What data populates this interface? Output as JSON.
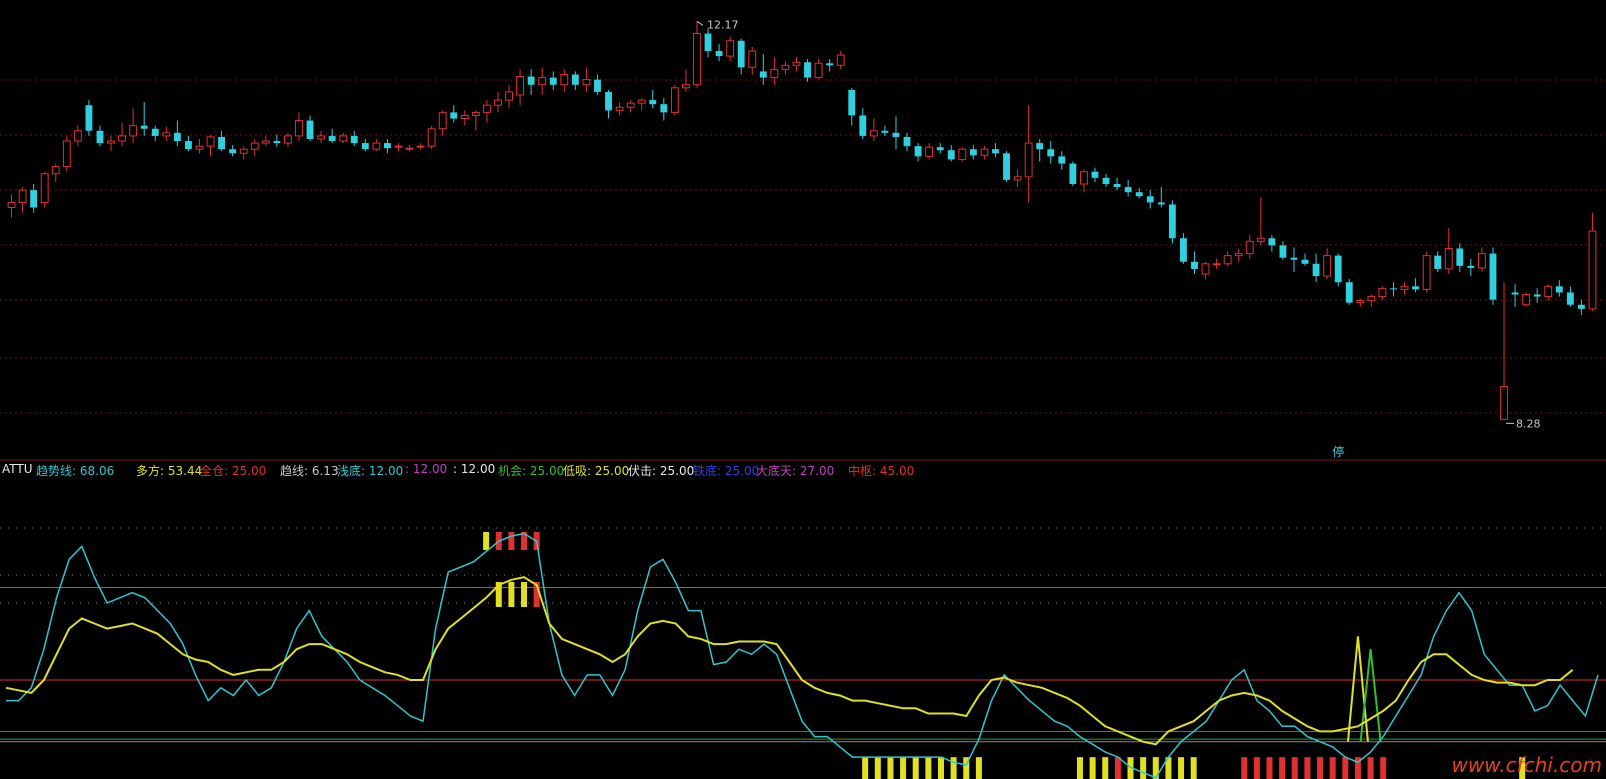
{
  "chart_data": [
    {
      "type": "candlestick",
      "title": "",
      "high_label": "12.17",
      "low_label": "8.28",
      "marker_text": "停",
      "y_range": [
        8.0,
        12.3
      ],
      "candles": [
        [
          10.35,
          10.48,
          10.25,
          10.4
        ],
        [
          10.4,
          10.55,
          10.3,
          10.52
        ],
        [
          10.52,
          10.58,
          10.3,
          10.35
        ],
        [
          10.4,
          10.7,
          10.35,
          10.68
        ],
        [
          10.68,
          10.78,
          10.6,
          10.75
        ],
        [
          10.75,
          11.05,
          10.7,
          11.0
        ],
        [
          11.0,
          11.15,
          10.95,
          11.1
        ],
        [
          11.35,
          11.4,
          11.05,
          11.1
        ],
        [
          11.1,
          11.15,
          10.95,
          10.98
        ],
        [
          10.98,
          11.05,
          10.9,
          11.0
        ],
        [
          11.0,
          11.18,
          10.95,
          11.05
        ],
        [
          11.05,
          11.32,
          10.98,
          11.15
        ],
        [
          11.15,
          11.38,
          11.05,
          11.12
        ],
        [
          11.12,
          11.15,
          11.0,
          11.05
        ],
        [
          11.05,
          11.14,
          11.0,
          11.08
        ],
        [
          11.08,
          11.2,
          10.95,
          11.0
        ],
        [
          11.0,
          11.05,
          10.9,
          10.92
        ],
        [
          10.92,
          11.02,
          10.88,
          10.95
        ],
        [
          10.95,
          11.06,
          10.85,
          11.04
        ],
        [
          11.04,
          11.1,
          10.9,
          10.92
        ],
        [
          10.92,
          10.96,
          10.85,
          10.88
        ],
        [
          10.88,
          10.95,
          10.82,
          10.92
        ],
        [
          10.92,
          11.02,
          10.85,
          10.98
        ],
        [
          10.98,
          11.05,
          10.95,
          11.0
        ],
        [
          11.0,
          11.06,
          10.94,
          10.98
        ],
        [
          10.98,
          11.08,
          10.94,
          11.05
        ],
        [
          11.05,
          11.28,
          11.0,
          11.2
        ],
        [
          11.2,
          11.25,
          11.0,
          11.02
        ],
        [
          11.02,
          11.1,
          10.98,
          11.05
        ],
        [
          11.05,
          11.12,
          10.98,
          11.0
        ],
        [
          11.0,
          11.08,
          10.98,
          11.05
        ],
        [
          11.05,
          11.1,
          10.95,
          10.98
        ],
        [
          10.98,
          11.02,
          10.9,
          10.92
        ],
        [
          10.92,
          11.02,
          10.9,
          10.98
        ],
        [
          10.98,
          11.02,
          10.88,
          10.93
        ],
        [
          10.95,
          10.98,
          10.9,
          10.95
        ],
        [
          10.93,
          10.96,
          10.9,
          10.93
        ],
        [
          10.95,
          10.98,
          10.92,
          10.95
        ],
        [
          10.95,
          11.15,
          10.92,
          11.12
        ],
        [
          11.12,
          11.3,
          11.05,
          11.28
        ],
        [
          11.28,
          11.35,
          11.18,
          11.22
        ],
        [
          11.22,
          11.3,
          11.15,
          11.25
        ],
        [
          11.25,
          11.3,
          11.1,
          11.28
        ],
        [
          11.28,
          11.4,
          11.18,
          11.35
        ],
        [
          11.35,
          11.48,
          11.28,
          11.4
        ],
        [
          11.4,
          11.55,
          11.32,
          11.48
        ],
        [
          11.45,
          11.7,
          11.35,
          11.63
        ],
        [
          11.63,
          11.7,
          11.45,
          11.55
        ],
        [
          11.55,
          11.72,
          11.45,
          11.62
        ],
        [
          11.62,
          11.68,
          11.5,
          11.55
        ],
        [
          11.55,
          11.7,
          11.48,
          11.65
        ],
        [
          11.65,
          11.68,
          11.5,
          11.55
        ],
        [
          11.55,
          11.72,
          11.48,
          11.6
        ],
        [
          11.6,
          11.65,
          11.45,
          11.48
        ],
        [
          11.48,
          11.5,
          11.22,
          11.3
        ],
        [
          11.3,
          11.38,
          11.25,
          11.33
        ],
        [
          11.33,
          11.4,
          11.28,
          11.37
        ],
        [
          11.37,
          11.42,
          11.3,
          11.4
        ],
        [
          11.4,
          11.5,
          11.32,
          11.36
        ],
        [
          11.36,
          11.42,
          11.2,
          11.28
        ],
        [
          11.28,
          11.55,
          11.25,
          11.52
        ],
        [
          11.52,
          11.7,
          11.48,
          11.55
        ],
        [
          11.55,
          12.17,
          11.52,
          12.05
        ],
        [
          12.05,
          12.1,
          11.82,
          11.88
        ],
        [
          11.88,
          11.95,
          11.78,
          11.83
        ],
        [
          11.83,
          12.02,
          11.78,
          11.98
        ],
        [
          11.98,
          12.0,
          11.65,
          11.72
        ],
        [
          11.72,
          11.92,
          11.65,
          11.88
        ],
        [
          11.68,
          11.85,
          11.55,
          11.62
        ],
        [
          11.62,
          11.82,
          11.55,
          11.7
        ],
        [
          11.7,
          11.78,
          11.65,
          11.74
        ],
        [
          11.74,
          11.82,
          11.68,
          11.77
        ],
        [
          11.77,
          11.8,
          11.58,
          11.62
        ],
        [
          11.62,
          11.8,
          11.6,
          11.76
        ],
        [
          11.76,
          11.8,
          11.68,
          11.74
        ],
        [
          11.74,
          11.88,
          11.7,
          11.84
        ],
        [
          11.5,
          11.52,
          11.15,
          11.25
        ],
        [
          11.25,
          11.32,
          11.02,
          11.05
        ],
        [
          11.05,
          11.22,
          11.0,
          11.1
        ],
        [
          11.1,
          11.15,
          11.05,
          11.08
        ],
        [
          11.08,
          11.24,
          10.92,
          11.04
        ],
        [
          11.04,
          11.08,
          10.9,
          10.95
        ],
        [
          10.95,
          10.98,
          10.8,
          10.85
        ],
        [
          10.85,
          10.98,
          10.82,
          10.94
        ],
        [
          10.94,
          10.98,
          10.88,
          10.91
        ],
        [
          10.91,
          10.96,
          10.8,
          10.82
        ],
        [
          10.82,
          10.94,
          10.8,
          10.92
        ],
        [
          10.92,
          10.96,
          10.82,
          10.86
        ],
        [
          10.86,
          10.95,
          10.82,
          10.92
        ],
        [
          10.92,
          10.98,
          10.84,
          10.88
        ],
        [
          10.88,
          10.9,
          10.6,
          10.62
        ],
        [
          10.62,
          10.72,
          10.55,
          10.65
        ],
        [
          10.65,
          11.35,
          10.4,
          10.98
        ],
        [
          10.98,
          11.02,
          10.8,
          10.92
        ],
        [
          10.92,
          11.0,
          10.78,
          10.85
        ],
        [
          10.85,
          10.9,
          10.72,
          10.78
        ],
        [
          10.78,
          10.8,
          10.56,
          10.58
        ],
        [
          10.58,
          10.72,
          10.5,
          10.7
        ],
        [
          10.7,
          10.74,
          10.6,
          10.64
        ],
        [
          10.64,
          10.68,
          10.55,
          10.58
        ],
        [
          10.58,
          10.64,
          10.52,
          10.55
        ],
        [
          10.55,
          10.62,
          10.46,
          10.5
        ],
        [
          10.5,
          10.54,
          10.44,
          10.46
        ],
        [
          10.46,
          10.52,
          10.34,
          10.4
        ],
        [
          10.4,
          10.55,
          10.35,
          10.38
        ],
        [
          10.38,
          10.42,
          10.0,
          10.05
        ],
        [
          10.05,
          10.1,
          9.8,
          9.82
        ],
        [
          9.82,
          9.92,
          9.7,
          9.75
        ],
        [
          9.7,
          9.82,
          9.65,
          9.8
        ],
        [
          9.8,
          9.85,
          9.75,
          9.8
        ],
        [
          9.8,
          9.92,
          9.78,
          9.88
        ],
        [
          9.88,
          9.95,
          9.82,
          9.9
        ],
        [
          9.9,
          10.08,
          9.85,
          10.02
        ],
        [
          10.02,
          10.45,
          9.98,
          10.05
        ],
        [
          10.05,
          10.08,
          9.92,
          9.98
        ],
        [
          9.98,
          10.02,
          9.84,
          9.86
        ],
        [
          9.86,
          9.96,
          9.72,
          9.84
        ],
        [
          9.84,
          9.9,
          9.78,
          9.8
        ],
        [
          9.8,
          9.9,
          9.62,
          9.68
        ],
        [
          9.68,
          9.95,
          9.65,
          9.88
        ],
        [
          9.88,
          9.9,
          9.58,
          9.62
        ],
        [
          9.62,
          9.65,
          9.4,
          9.42
        ],
        [
          9.42,
          9.46,
          9.38,
          9.44
        ],
        [
          9.44,
          9.5,
          9.38,
          9.48
        ],
        [
          9.48,
          9.58,
          9.45,
          9.56
        ],
        [
          9.56,
          9.62,
          9.48,
          9.55
        ],
        [
          9.55,
          9.62,
          9.5,
          9.58
        ],
        [
          9.58,
          9.66,
          9.52,
          9.55
        ],
        [
          9.55,
          9.92,
          9.52,
          9.88
        ],
        [
          9.88,
          9.92,
          9.72,
          9.75
        ],
        [
          9.75,
          10.15,
          9.7,
          9.95
        ],
        [
          9.95,
          10.0,
          9.72,
          9.78
        ],
        [
          9.78,
          9.85,
          9.68,
          9.76
        ],
        [
          9.76,
          9.96,
          9.72,
          9.9
        ],
        [
          9.9,
          9.96,
          9.4,
          9.45
        ],
        [
          8.28,
          9.62,
          8.28,
          8.6
        ],
        [
          9.52,
          9.6,
          9.38,
          9.5
        ],
        [
          9.4,
          9.52,
          9.38,
          9.5
        ],
        [
          9.5,
          9.56,
          9.42,
          9.48
        ],
        [
          9.48,
          9.6,
          9.44,
          9.58
        ],
        [
          9.58,
          9.64,
          9.48,
          9.52
        ],
        [
          9.52,
          9.58,
          9.38,
          9.4
        ],
        [
          9.4,
          9.45,
          9.3,
          9.36
        ],
        [
          9.36,
          10.3,
          9.34,
          10.12
        ]
      ]
    },
    {
      "type": "line",
      "title": "ATTU",
      "legend": [
        {
          "label": "趋势线: 68.06",
          "color": "#2fc6cf"
        },
        {
          "label": "多方: 53.44",
          "color": "#e0e020"
        },
        {
          "label": "全仓: 25.00",
          "color": "#e03030"
        },
        {
          "label": "趋线: 6.13",
          "color": "#c8c8c8"
        },
        {
          "label": "浅底: 12.00",
          "color": "#2fc6cf"
        },
        {
          "label": ": 12.00",
          "color": "#c040c0"
        },
        {
          "label": ": 12.00",
          "color": "#e8e8e8"
        },
        {
          "label": "机会: 25.00",
          "color": "#30c030"
        },
        {
          "label": "低吸: 25.00",
          "color": "#e0e020"
        },
        {
          "label": "伏击: 25.00",
          "color": "#e8e8e8"
        },
        {
          "label": "铁底: 25.00",
          "color": "#3040e0"
        },
        {
          "label": "大底天: 27.00",
          "color": "#c040c0"
        },
        {
          "label": "中枢: 45.00",
          "color": "#e03030"
        }
      ],
      "y_range": [
        0,
        100
      ],
      "series": [
        {
          "name": "趋势线",
          "color": "#2fc6cf",
          "values": [
            20,
            20,
            25,
            40,
            60,
            75,
            80,
            68,
            58,
            60,
            62,
            60,
            55,
            50,
            42,
            30,
            20,
            25,
            22,
            28,
            22,
            25,
            35,
            48,
            55,
            45,
            40,
            35,
            28,
            25,
            22,
            18,
            14,
            12,
            48,
            70,
            72,
            74,
            78,
            82,
            84,
            85,
            82,
            50,
            30,
            22,
            30,
            30,
            22,
            32,
            55,
            72,
            75,
            66,
            55,
            55,
            34,
            35,
            40,
            38,
            42,
            38,
            25,
            12,
            6,
            6,
            2,
            -2,
            -2,
            -2,
            -2,
            -2,
            -2,
            -2,
            -2,
            -4,
            -5,
            5,
            20,
            30,
            25,
            20,
            16,
            12,
            10,
            6,
            3,
            0,
            -2,
            -6,
            -8,
            -10,
            -2,
            4,
            8,
            12,
            20,
            28,
            32,
            20,
            16,
            10,
            10,
            6,
            4,
            2,
            -2,
            -4,
            0,
            6,
            14,
            22,
            30,
            45,
            55,
            62,
            55,
            38,
            32,
            26,
            26,
            16,
            18,
            26,
            20,
            14,
            30
          ]
        },
        {
          "name": "多方",
          "color": "#e0e020",
          "values": [
            25,
            24,
            23,
            28,
            38,
            48,
            52,
            50,
            48,
            49,
            50,
            48,
            46,
            42,
            38,
            36,
            35,
            32,
            30,
            31,
            32,
            32,
            35,
            40,
            42,
            42,
            40,
            38,
            35,
            33,
            31,
            30,
            28,
            28,
            40,
            48,
            52,
            56,
            60,
            65,
            67,
            68,
            65,
            50,
            44,
            42,
            40,
            38,
            35,
            38,
            45,
            50,
            51,
            50,
            45,
            44,
            42,
            42,
            43,
            43,
            43,
            42,
            35,
            28,
            25,
            23,
            22,
            20,
            20,
            19,
            18,
            17,
            17,
            15,
            15,
            15,
            14,
            22,
            28,
            29,
            27,
            26,
            25,
            23,
            21,
            18,
            14,
            10,
            8,
            6,
            4,
            3,
            8,
            10,
            12,
            16,
            20,
            22,
            23,
            22,
            20,
            16,
            13,
            10,
            8,
            8,
            9,
            10,
            13,
            16,
            20,
            28,
            35,
            38,
            38,
            34,
            30,
            28,
            27,
            27,
            26,
            26,
            28,
            28,
            32
          ]
        }
      ],
      "spikes": [
        {
          "index": 107,
          "value": 45,
          "color": "#e0e020"
        },
        {
          "index": 108,
          "value": 40,
          "color": "#30c030"
        }
      ],
      "ref_lines": [
        {
          "value": 64,
          "color": "#2aa02a"
        },
        {
          "value": 28,
          "color": "#e03030"
        },
        {
          "value": 8,
          "color": "#e03030"
        }
      ],
      "bar_columns": [
        {
          "start": 38,
          "end": 42,
          "colors": [
            "#e0e020",
            "#e03030",
            "#e03030",
            "#e03030",
            "#e03030"
          ],
          "band": "top"
        },
        {
          "start": 39,
          "end": 42,
          "colors": [
            "#e0e020",
            "#e0e020",
            "#e0e020",
            "#e03030"
          ],
          "band": "mid"
        },
        {
          "start": 68,
          "end": 77,
          "colors": [
            "#e0e020"
          ],
          "band": "bottom"
        },
        {
          "start": 85,
          "end": 92,
          "colors": [
            "#e0e020",
            "#e0e020",
            "#e0e020",
            "#e03030",
            "#e0e020",
            "#e0e020",
            "#e0e020",
            "#e0e020"
          ],
          "band": "bottom"
        },
        {
          "start": 93,
          "end": 94,
          "colors": [
            "#e0e020"
          ],
          "band": "bottom"
        },
        {
          "start": 98,
          "end": 109,
          "colors": [
            "#e03030"
          ],
          "band": "bottom"
        },
        {
          "start": 120,
          "end": 120,
          "colors": [
            "#e0e020"
          ],
          "band": "bottom"
        }
      ]
    }
  ],
  "watermark": "www.cfchi.com"
}
